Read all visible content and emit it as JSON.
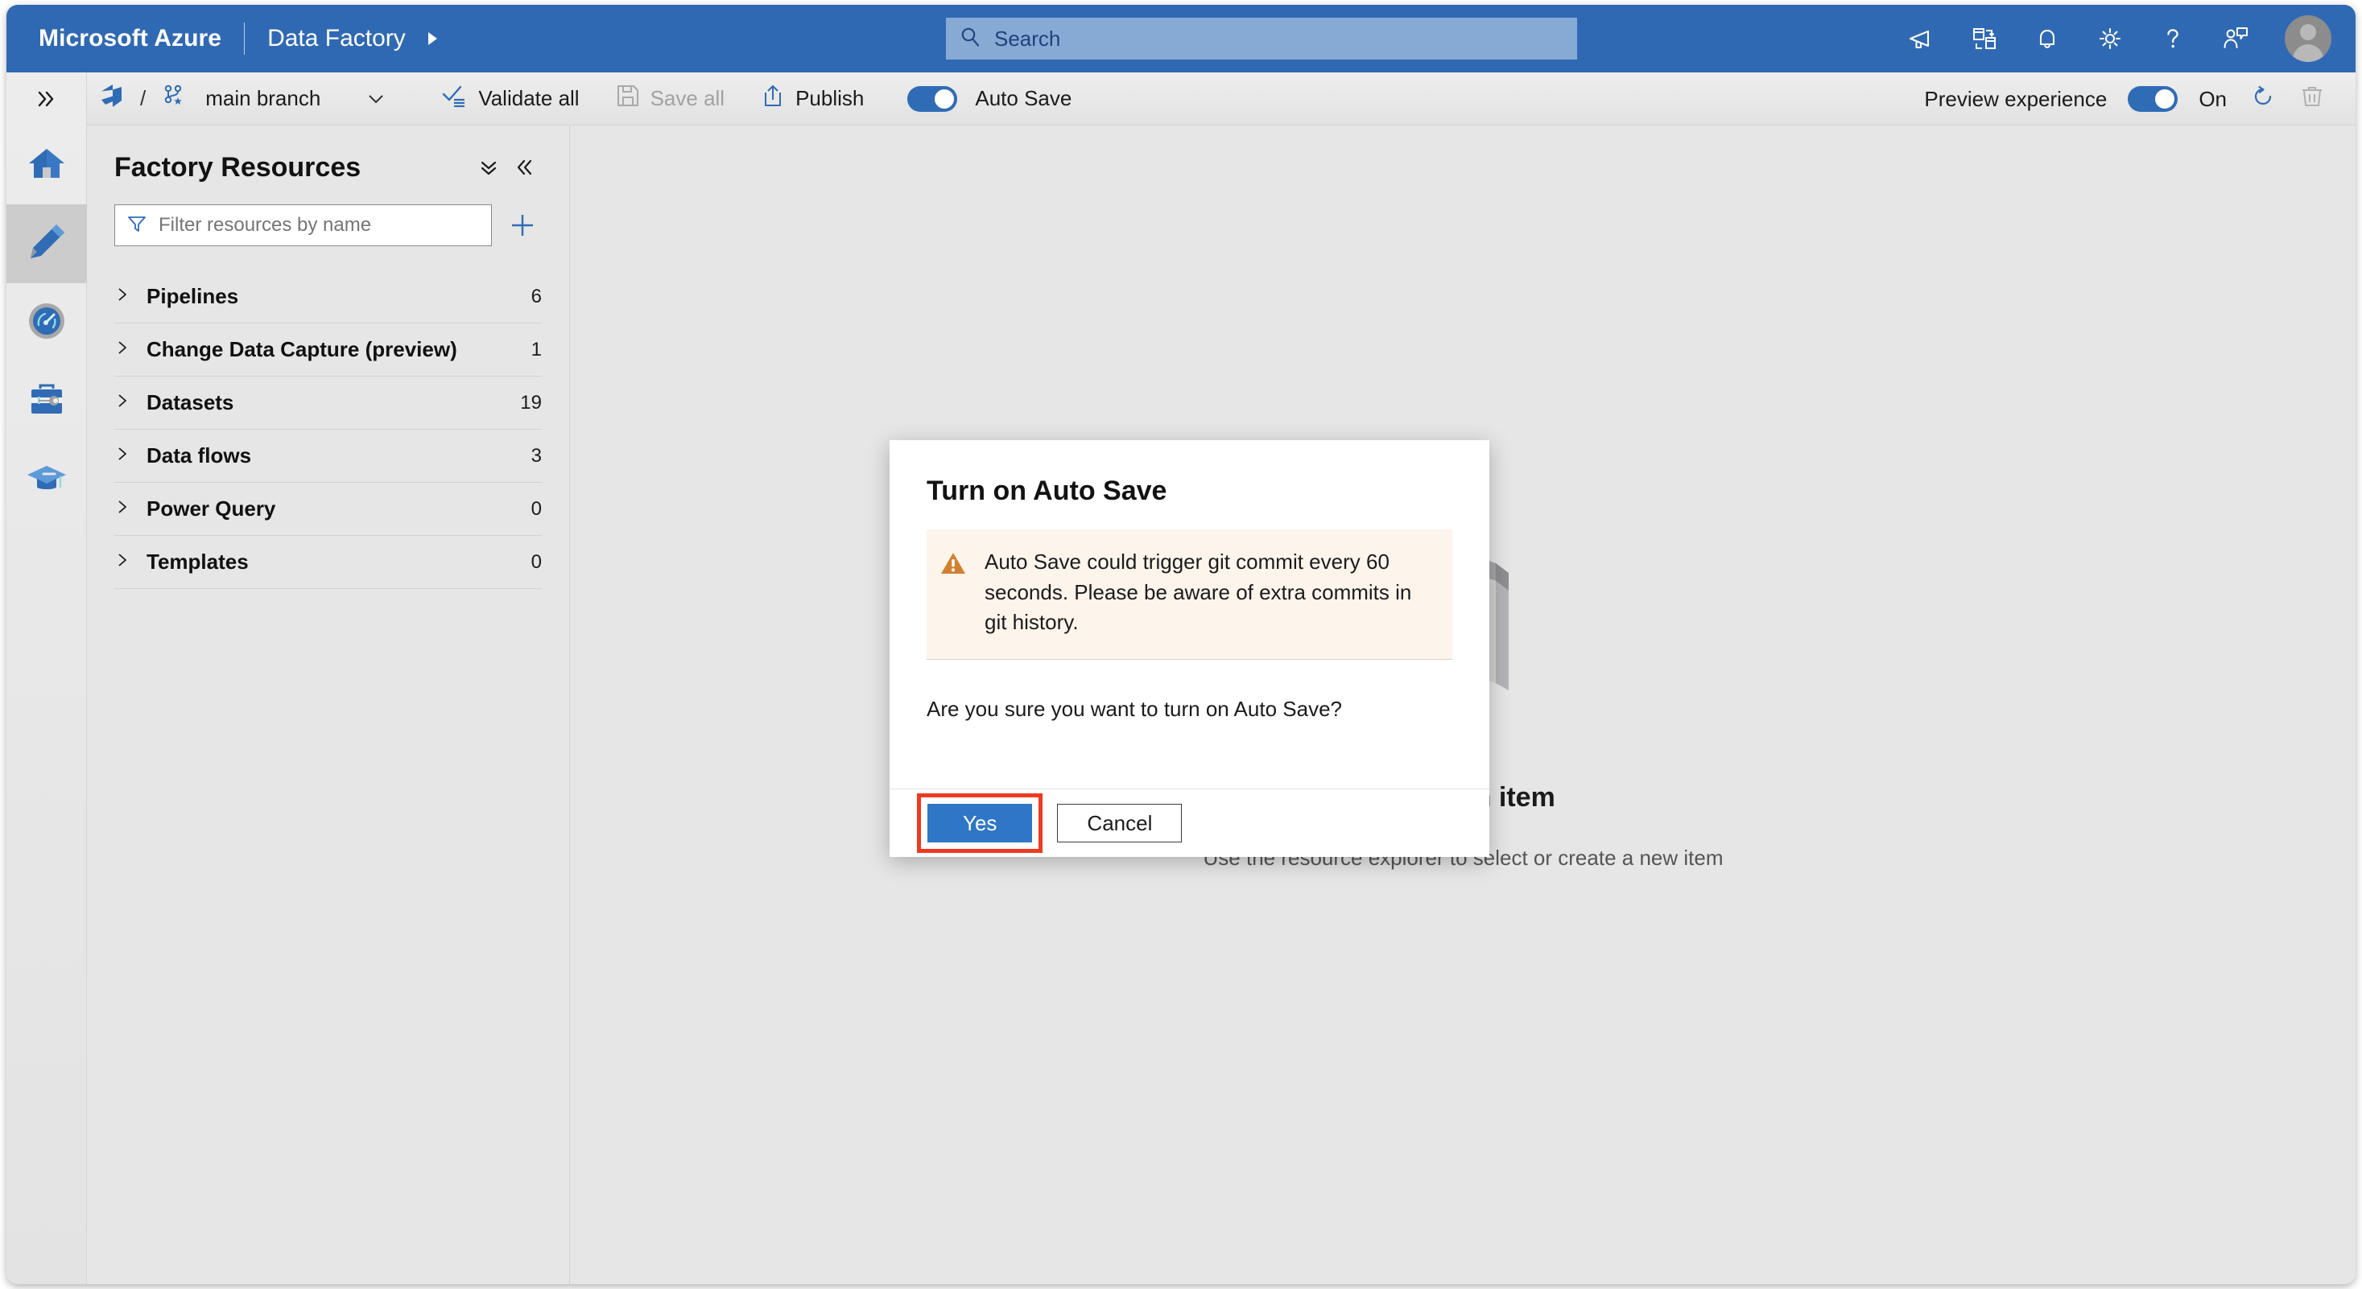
{
  "header": {
    "brand": "Microsoft Azure",
    "service": "Data Factory",
    "service_caret": "play-caret-icon",
    "search": {
      "placeholder": "Search",
      "icon": "search-icon"
    },
    "icons": [
      {
        "name": "announcements-icon",
        "label": "Announcements"
      },
      {
        "name": "directories-subscriptions-icon",
        "label": "Directories + subscriptions"
      },
      {
        "name": "notifications-bell-icon",
        "label": "Notifications"
      },
      {
        "name": "settings-gear-icon",
        "label": "Settings"
      },
      {
        "name": "help-question-icon",
        "label": "Help"
      },
      {
        "name": "feedback-icon",
        "label": "Feedback"
      }
    ],
    "avatar": "user-avatar"
  },
  "commandbar": {
    "repo_icon": "azure-devops-icon",
    "separator": "/",
    "branch_icon": "git-branch-icon",
    "branch_name": "main branch",
    "branch_caret": "chevron-down-icon",
    "validate_all": "Validate all",
    "save_all": "Save all",
    "save_all_disabled": true,
    "publish": "Publish",
    "auto_save_label": "Auto Save",
    "auto_save_state": "on",
    "preview_experience_label": "Preview experience",
    "preview_experience_state": "On",
    "refresh_icon": "refresh-icon",
    "discard_icon": "discard-trash-icon",
    "discard_disabled": true
  },
  "rail": {
    "expand_icon": "chevron-double-right-icon",
    "items": [
      {
        "name": "home",
        "icon": "home-icon",
        "active": false
      },
      {
        "name": "author",
        "icon": "pencil-icon",
        "active": true
      },
      {
        "name": "monitor",
        "icon": "gauge-icon",
        "active": false
      },
      {
        "name": "manage",
        "icon": "toolbox-icon",
        "active": false
      },
      {
        "name": "learning-center",
        "icon": "graduation-cap-icon",
        "active": false
      }
    ]
  },
  "sidebar": {
    "title": "Factory Resources",
    "collapse_all_icon": "chevron-double-down-icon",
    "collapse_panel_icon": "chevron-double-left-icon",
    "filter": {
      "placeholder": "Filter resources by name",
      "value": "",
      "icon": "funnel-icon"
    },
    "add_icon": "plus-icon",
    "tree": [
      {
        "label": "Pipelines",
        "count": "6"
      },
      {
        "label": "Change Data Capture (preview)",
        "count": "1"
      },
      {
        "label": "Datasets",
        "count": "19"
      },
      {
        "label": "Data flows",
        "count": "3"
      },
      {
        "label": "Power Query",
        "count": "0"
      },
      {
        "label": "Templates",
        "count": "0"
      }
    ]
  },
  "canvas": {
    "empty_title": "Select an item",
    "empty_subtitle": "Use the resource explorer to select or create a new item",
    "illustration": "isometric-grid-illustration"
  },
  "dialog": {
    "title": "Turn on Auto Save",
    "warning_icon": "warning-triangle-icon",
    "warning_text": "Auto Save could trigger git commit every 60 seconds. Please be aware of extra commits in git history.",
    "question": "Are you sure you want to turn on Auto Save?",
    "confirm_label": "Yes",
    "cancel_label": "Cancel",
    "highlighted_button": "Yes"
  },
  "colors": {
    "azure_blue": "#3069b3",
    "accent_blue": "#2f77c6",
    "toggle_on": "#2f6cb5",
    "warning_orange": "#d2802f",
    "warning_bg": "#fdf4ec",
    "highlight_red": "#ee3a21",
    "chrome_gray": "#e6e6e6"
  }
}
